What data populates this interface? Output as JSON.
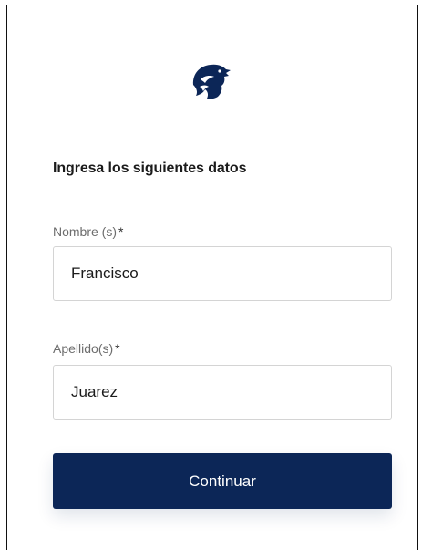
{
  "colors": {
    "brand": "#0c2657",
    "button_text": "#ffffff",
    "label": "#6d6d6d",
    "field_border": "#d4d4d4"
  },
  "logo": {
    "icon": "eagle-head-logo"
  },
  "form": {
    "heading": "Ingresa los siguientes datos",
    "name_field": {
      "label": "Nombre (s)",
      "required_marker": "*",
      "value": "Francisco"
    },
    "lastname_field": {
      "label": "Apellido(s)",
      "required_marker": "*",
      "value": "Juarez"
    },
    "submit_label": "Continuar"
  }
}
